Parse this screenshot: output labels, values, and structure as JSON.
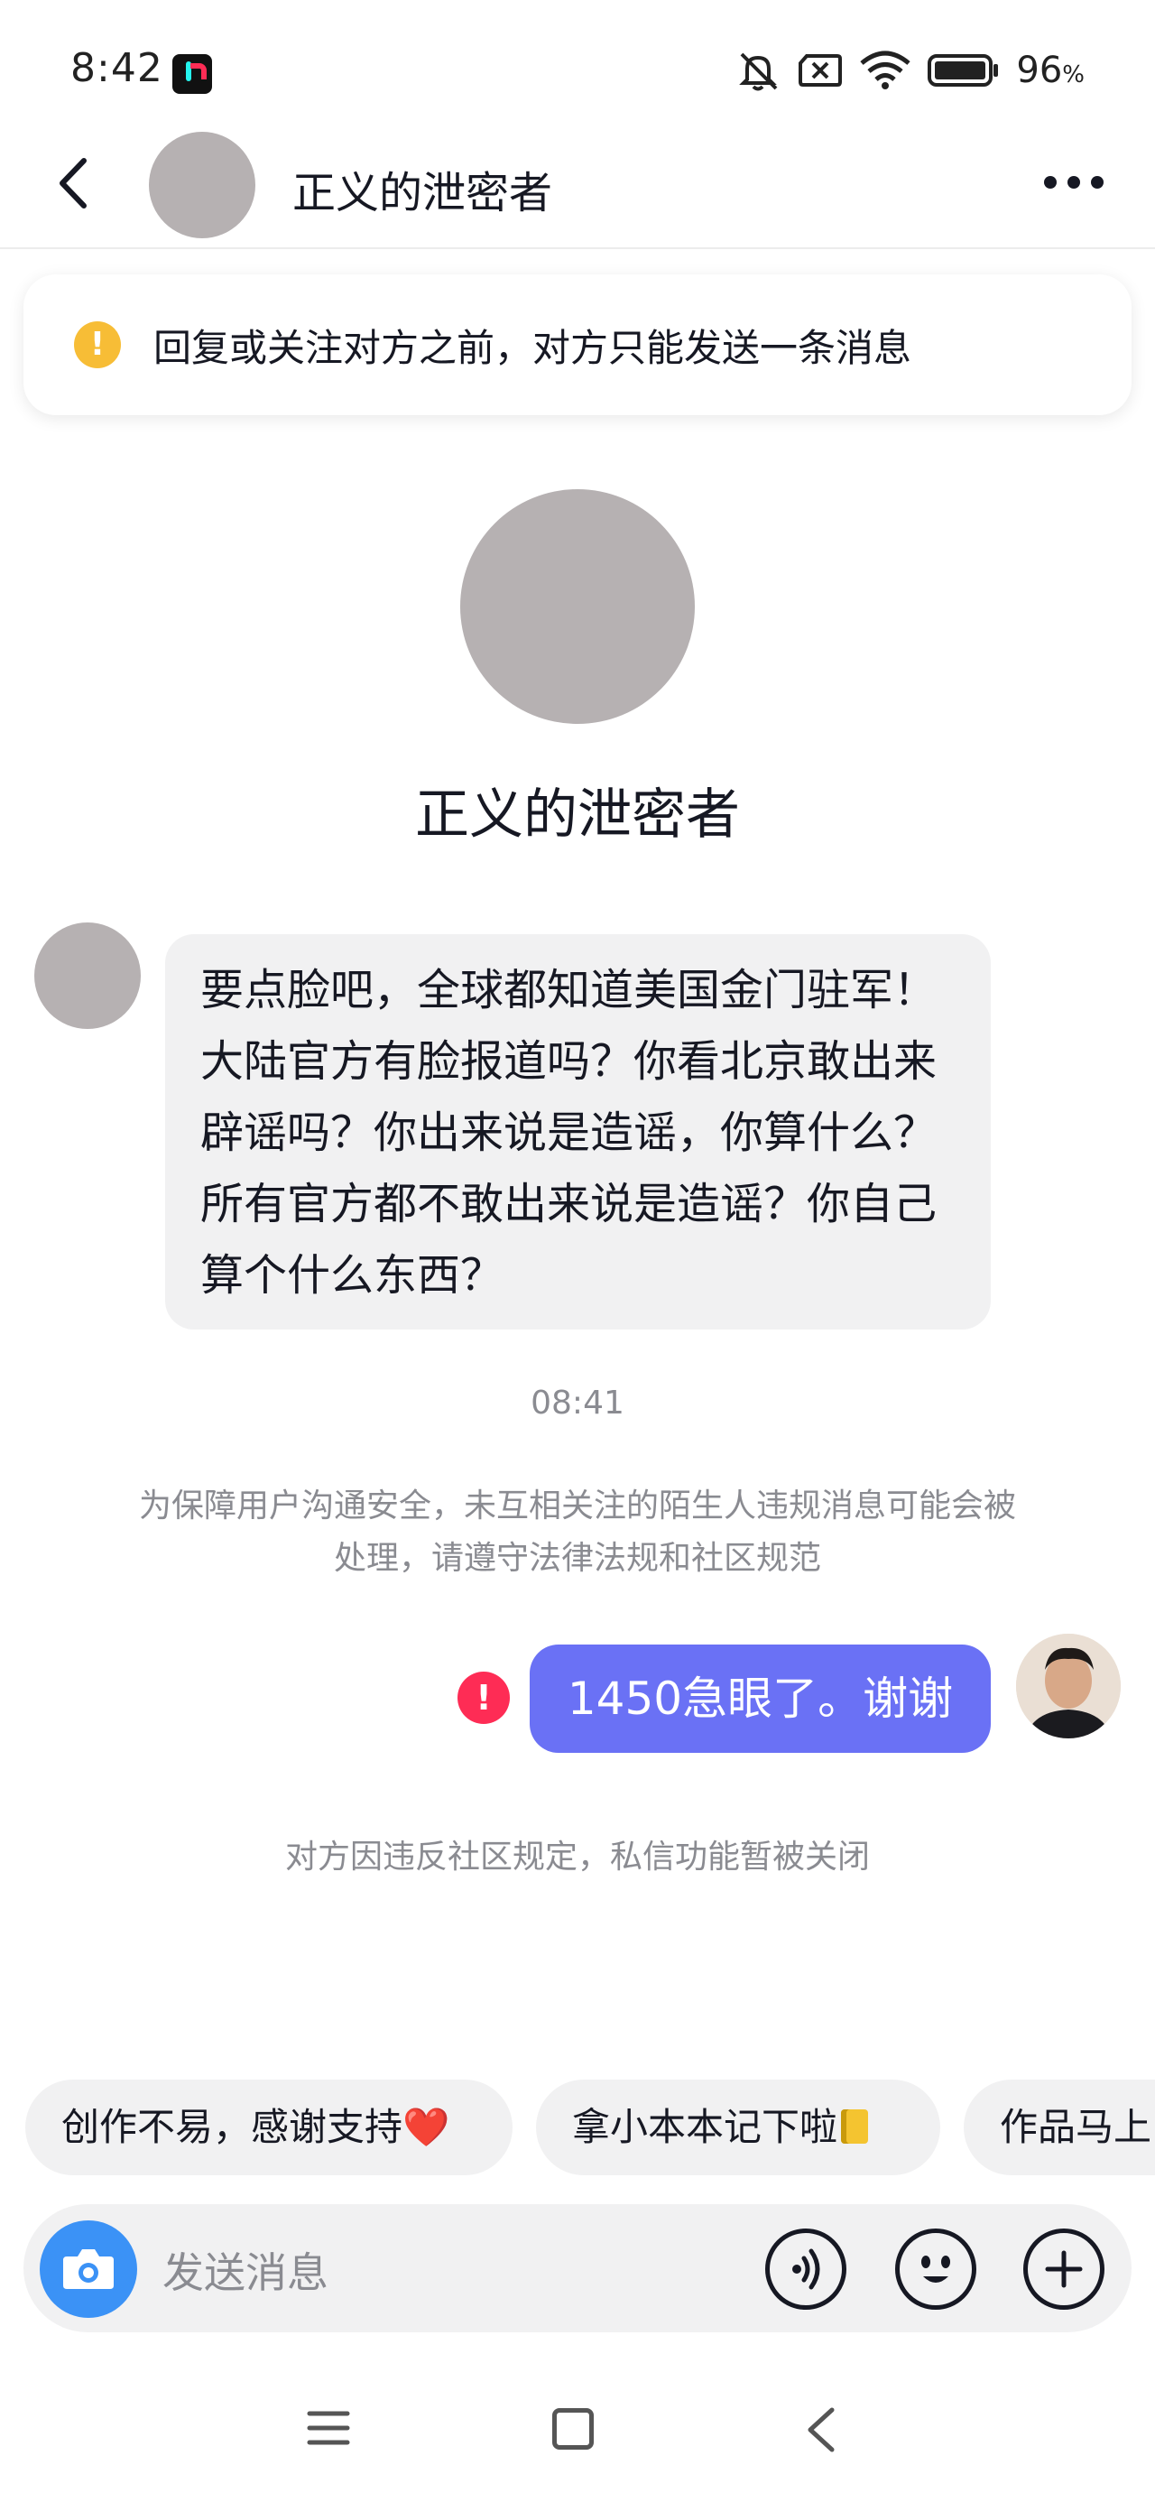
{
  "status_bar": {
    "time": "8:42",
    "battery_percent": "96",
    "battery_unit": "%",
    "icons": [
      "tiktok-app-icon",
      "mute-bell-icon",
      "no-sim-icon",
      "wifi-icon",
      "battery-icon"
    ]
  },
  "header": {
    "title": "正义的泄密者",
    "icons": [
      "back-chevron-icon",
      "more-dots-icon"
    ]
  },
  "warning_banner": {
    "icon": "exclamation-icon",
    "icon_glyph": "!",
    "text": "回复或关注对方之前，对方只能发送一条消息"
  },
  "profile": {
    "name": "正义的泄密者"
  },
  "messages": {
    "incoming_text": "要点脸吧，全球都知道美国金门驻军！大陆官方有脸报道吗？你看北京敢出来辟谣吗？你出来说是造谣，你算什么？所有官方都不敢出来说是造谣？你自己算个什么东西？",
    "timestamp": "08:41",
    "safety_note": "为保障用户沟通安全，未互相关注的陌生人违规消息可能会被处理，请遵守法律法规和社区规范",
    "outgoing_text": "1450急眼了。谢谢",
    "failed_icon_glyph": "!",
    "closed_note": "对方因违反社区规定，私信功能暂被关闭"
  },
  "quick_replies": {
    "chip1": "创作不易，感谢支持",
    "chip1_emoji": "❤️",
    "chip2": "拿小本本记下啦",
    "chip3": "作品马上"
  },
  "composer": {
    "placeholder": "发送消息",
    "icons": [
      "camera-icon",
      "voice-icon",
      "emoji-icon",
      "plus-icon"
    ]
  },
  "nav_bar": {
    "icons": [
      "menu-icon",
      "home-square-icon",
      "back-triangle-icon"
    ]
  },
  "colors": {
    "accent_bubble": "#6a71f5",
    "warning": "#f7bd36",
    "error": "#fe2c55",
    "camera_button": "#3b92f6"
  }
}
